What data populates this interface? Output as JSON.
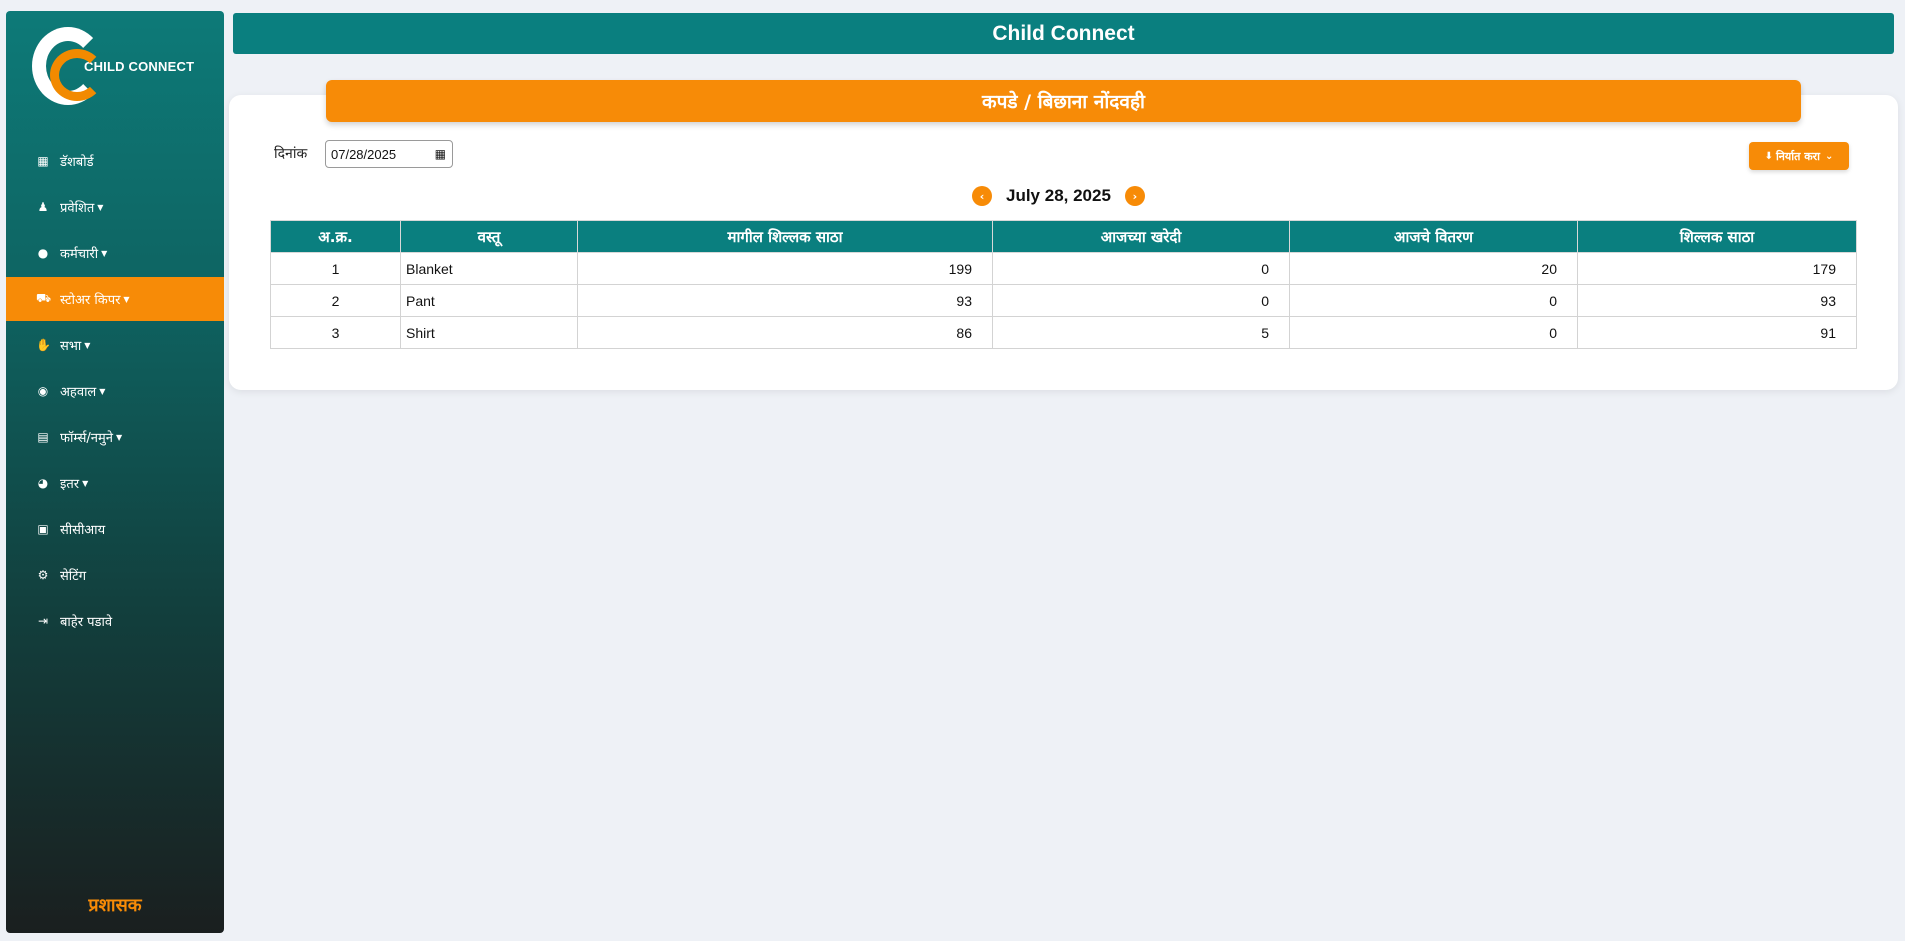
{
  "sidebar": {
    "logo_text": "CHILD CONNECT",
    "items": [
      {
        "label": "डॅशबोर्ड",
        "icon": "dashboard-icon",
        "dropdown": false,
        "active": false
      },
      {
        "label": "प्रवेशित",
        "icon": "child-icon",
        "dropdown": true,
        "active": false
      },
      {
        "label": "कर्मचारी",
        "icon": "user-icon",
        "dropdown": true,
        "active": false
      },
      {
        "label": "स्टोअर किपर",
        "icon": "cart-icon",
        "dropdown": true,
        "active": true
      },
      {
        "label": "सभा",
        "icon": "handshake-icon",
        "dropdown": true,
        "active": false
      },
      {
        "label": "अहवाल",
        "icon": "report-icon",
        "dropdown": true,
        "active": false
      },
      {
        "label": "फॉर्म्स/नमुने",
        "icon": "form-icon",
        "dropdown": true,
        "active": false
      },
      {
        "label": "इतर",
        "icon": "other-icon",
        "dropdown": true,
        "active": false
      },
      {
        "label": "सीसीआय",
        "icon": "id-card-icon",
        "dropdown": false,
        "active": false
      },
      {
        "label": "सेटिंग",
        "icon": "gear-icon",
        "dropdown": false,
        "active": false
      },
      {
        "label": "बाहेर पडावे",
        "icon": "logout-icon",
        "dropdown": false,
        "active": false
      }
    ],
    "role": "प्रशासक"
  },
  "header": {
    "title": "Child Connect"
  },
  "page": {
    "title": "कपडे / बिछाना नोंदवही",
    "date_label": "दिनांक",
    "date_value": "07/28/2025",
    "export_label": "निर्यात करा",
    "current_date": "July 28, 2025"
  },
  "table": {
    "headers": [
      "अ.क्र.",
      "वस्तू",
      "मागील शिल्लक साठा",
      "आजच्या खरेदी",
      "आजचे वितरण",
      "शिल्लक साठा"
    ],
    "rows": [
      [
        "1",
        "Blanket",
        "199",
        "0",
        "20",
        "179"
      ],
      [
        "2",
        "Pant",
        "93",
        "0",
        "0",
        "93"
      ],
      [
        "3",
        "Shirt",
        "86",
        "5",
        "0",
        "91"
      ]
    ]
  },
  "colors": {
    "accent": "#f78b07",
    "teal": "#0a7f7f"
  }
}
